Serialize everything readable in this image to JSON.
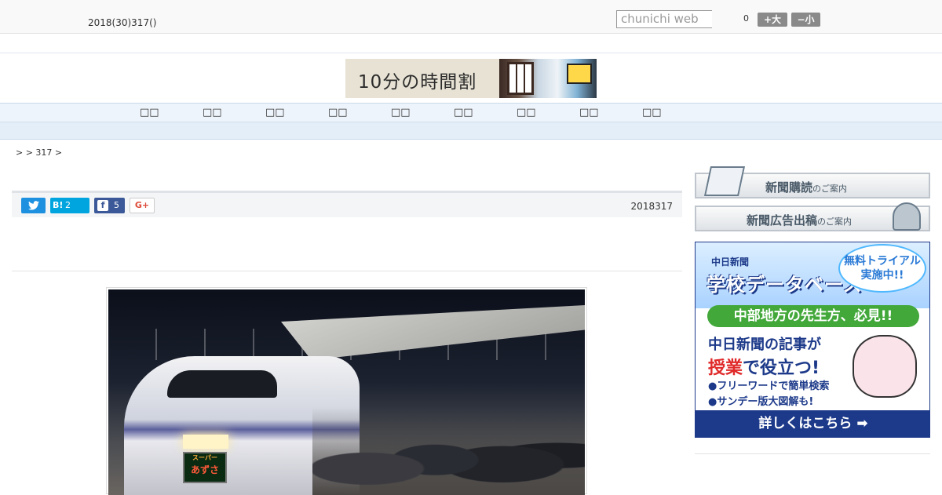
{
  "header": {
    "date": "2018(30)317()",
    "search_placeholder": "chunichi web",
    "font_size_value": "0",
    "font_up_label": "+大",
    "font_down_label": "−小"
  },
  "banner": {
    "text": "10分の時間割"
  },
  "nav": {
    "items": [
      {
        "label": "□□"
      },
      {
        "label": "□□"
      },
      {
        "label": "□□"
      },
      {
        "label": "□□"
      },
      {
        "label": "□□"
      },
      {
        "label": "□□"
      },
      {
        "label": "□□"
      },
      {
        "label": "□□"
      },
      {
        "label": "□□"
      }
    ]
  },
  "breadcrumb": ">  > 317 >",
  "article": {
    "share": {
      "twitter_icon": "twitter-icon",
      "hatena_label": "B!",
      "hatena_count": "2",
      "facebook_icon": "f",
      "facebook_count": "5",
      "gplus_label": "G+"
    },
    "date": "2018317",
    "photo_dest_top": "スーパー",
    "photo_dest_main": "あずさ"
  },
  "sidebar": {
    "ad1_main": "新聞購読",
    "ad1_sub": "のご案内",
    "ad2_main": "新聞広告出稿",
    "ad2_sub": "のご案内",
    "db_ad": {
      "paper": "中日新聞",
      "title": "学校データベース",
      "trial": "無料トライアル実施中!!",
      "green": "中部地方の先生方、必見!!",
      "line1": "中日新聞の記事が",
      "line2_red": "授業",
      "line2_rest": "で役立つ!",
      "bullet1": "●フリーワードで簡単検索",
      "bullet2": "●サンデー版大図解も!",
      "cta": "詳しくはこちら ➡"
    }
  }
}
